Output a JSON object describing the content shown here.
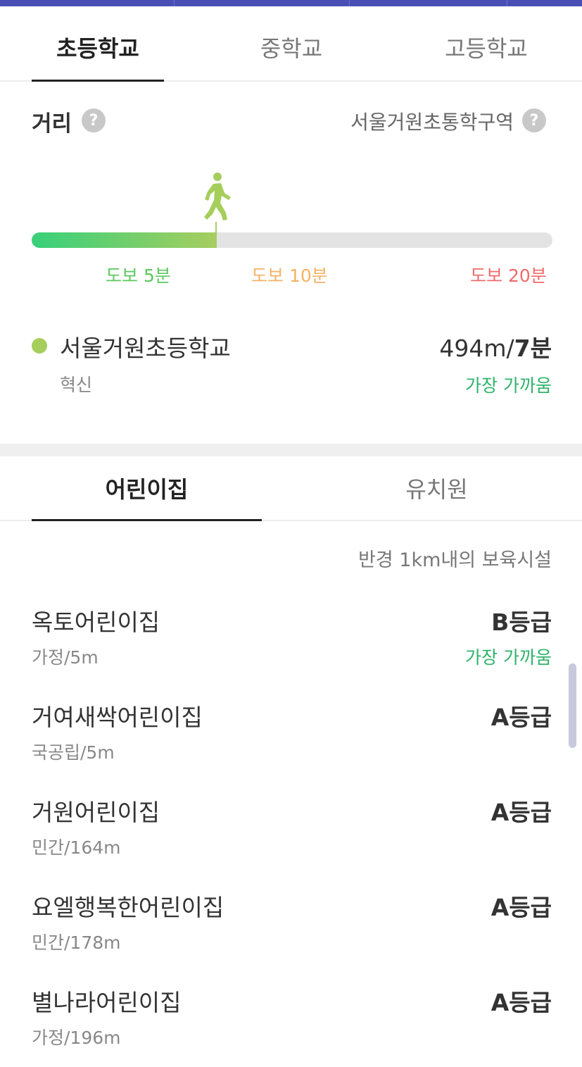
{
  "school_tabs": {
    "items": [
      {
        "label": "초등학교",
        "active": true
      },
      {
        "label": "중학교",
        "active": false
      },
      {
        "label": "고등학교",
        "active": false
      }
    ]
  },
  "distance": {
    "title": "거리",
    "help_icon": "question-icon",
    "district": "서울거원초통학구역",
    "progress_fraction": 0.355,
    "labels": [
      {
        "text": "도보 5분",
        "color": "#5cc85f"
      },
      {
        "text": "도보 10분",
        "color": "#f5b266"
      },
      {
        "text": "도보 20분",
        "color": "#f06a6a"
      }
    ]
  },
  "school": {
    "name": "서울거원초등학교",
    "type": "혁신",
    "distance_m": "494m/",
    "distance_min": "7분",
    "nearest": "가장 가까움"
  },
  "care_tabs": {
    "items": [
      {
        "label": "어린이집",
        "active": true
      },
      {
        "label": "유치원",
        "active": false
      }
    ]
  },
  "radius_note": "반경 1km내의 보육시설",
  "facilities": [
    {
      "name": "옥토어린이집",
      "sub": "가정/5m",
      "grade": "B등급",
      "nearest": "가장 가까움"
    },
    {
      "name": "거여새싹어린이집",
      "sub": "국공립/5m",
      "grade": "A등급"
    },
    {
      "name": "거원어린이집",
      "sub": "민간/164m",
      "grade": "A등급"
    },
    {
      "name": "요엘행복한어린이집",
      "sub": "민간/178m",
      "grade": "A등급"
    },
    {
      "name": "별나라어린이집",
      "sub": "가정/196m",
      "grade": "A등급"
    }
  ],
  "colors": {
    "accent_green": "#2eb36a",
    "bar_start": "#37d07a",
    "bar_end": "#a7cd5f",
    "top_bar": "#4a4fb5"
  }
}
